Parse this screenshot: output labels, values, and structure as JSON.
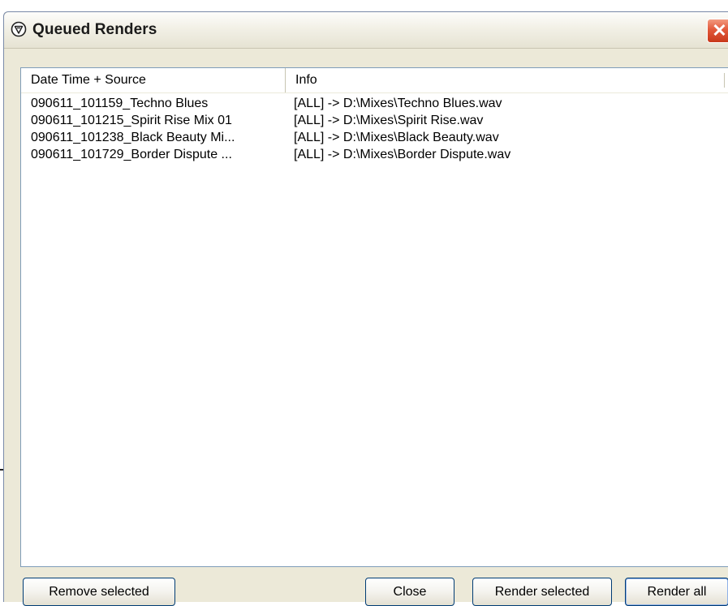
{
  "window": {
    "title": "Queued Renders",
    "close_glyph": "✕"
  },
  "list": {
    "columns": [
      "Date Time + Source",
      "Info"
    ],
    "rows": [
      {
        "source": "090611_101159_Techno Blues",
        "info": "[ALL] -> D:\\Mixes\\Techno Blues.wav"
      },
      {
        "source": "090611_101215_Spirit Rise Mix 01",
        "info": "[ALL] -> D:\\Mixes\\Spirit Rise.wav"
      },
      {
        "source": "090611_101238_Black Beauty Mi...",
        "info": "[ALL] -> D:\\Mixes\\Black Beauty.wav"
      },
      {
        "source": "090611_101729_Border Dispute ...",
        "info": "[ALL] -> D:\\Mixes\\Border Dispute.wav"
      }
    ]
  },
  "buttons": {
    "remove_selected": "Remove selected",
    "close": "Close",
    "render_selected": "Render selected",
    "render_all": "Render all"
  },
  "icons": {
    "app": "app-logo-icon",
    "close": "close-icon"
  },
  "colors": {
    "window_bg": "#ece9d8",
    "close_button": "#e2593a",
    "button_border": "#003c74"
  }
}
